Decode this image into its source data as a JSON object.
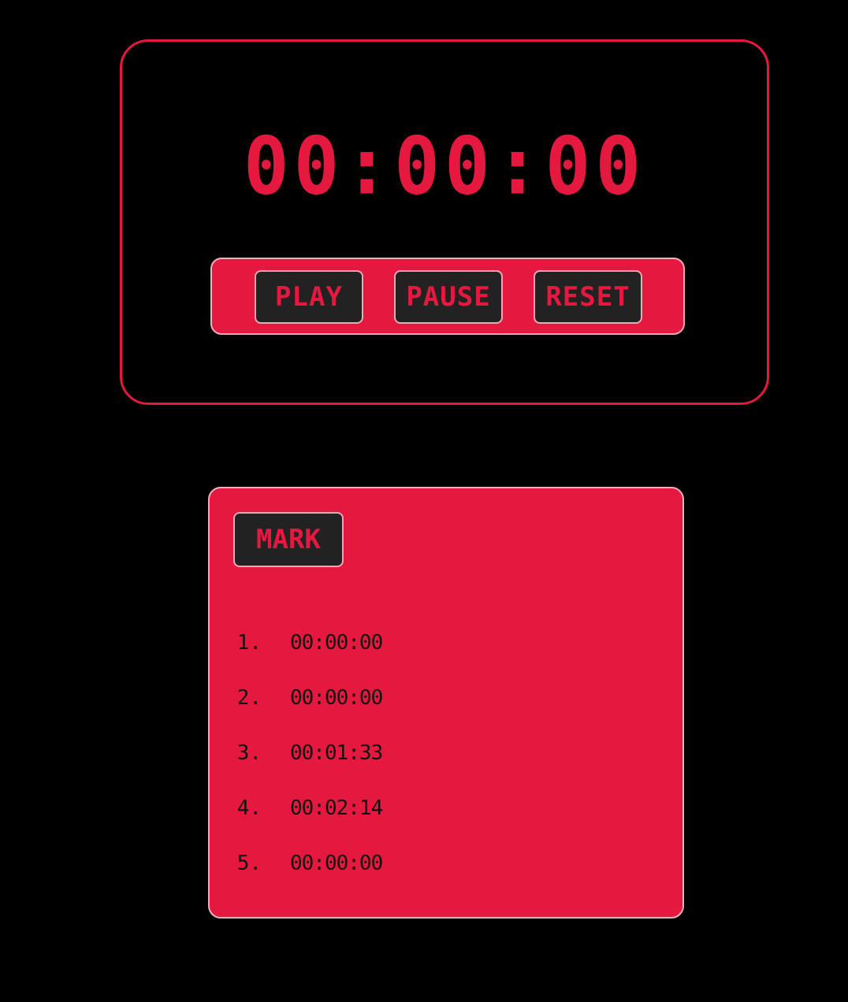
{
  "stopwatch": {
    "time": "00:00:00",
    "buttons": {
      "play": "PLAY",
      "pause": "PAUSE",
      "reset": "RESET"
    }
  },
  "laps": {
    "mark_label": "MARK",
    "items": [
      {
        "number": "1.",
        "time": "00:00:00"
      },
      {
        "number": "2.",
        "time": "00:00:00"
      },
      {
        "number": "3.",
        "time": "00:01:33"
      },
      {
        "number": "4.",
        "time": "00:02:14"
      },
      {
        "number": "5.",
        "time": "00:00:00"
      }
    ]
  },
  "colors": {
    "accent": "#e5193f",
    "background": "#000000",
    "button_bg": "#222222"
  }
}
